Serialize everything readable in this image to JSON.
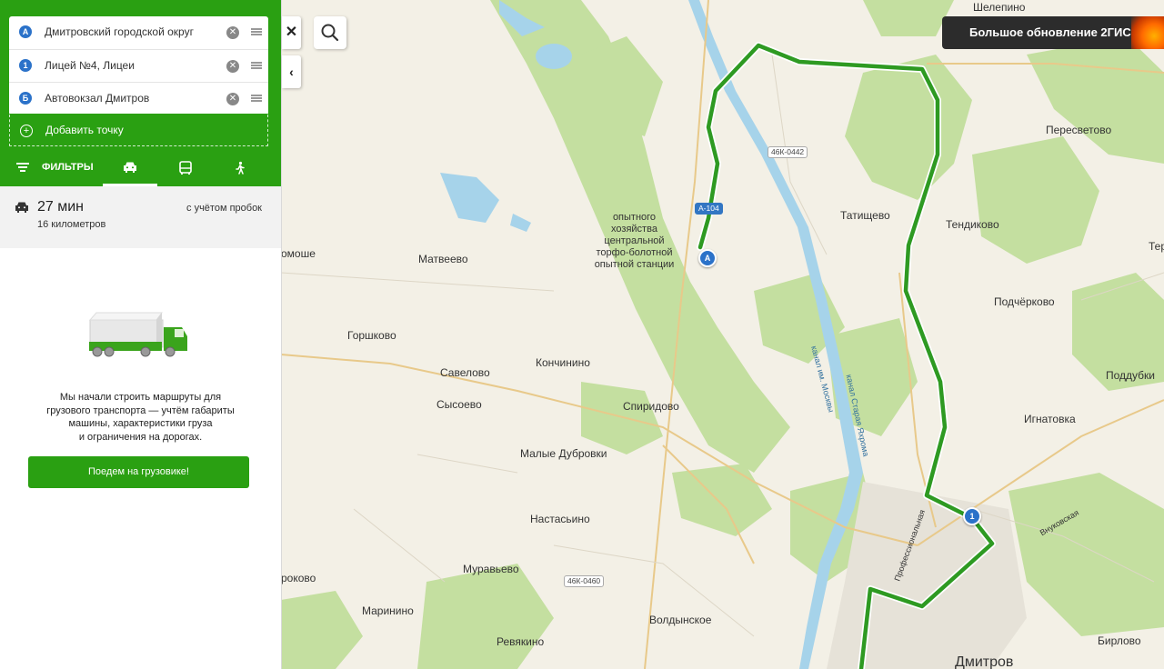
{
  "route_points": [
    {
      "marker": "А",
      "label": "Дмитровский городской округ"
    },
    {
      "marker": "1",
      "label": "Лицей №4, Лицеи"
    },
    {
      "marker": "Б",
      "label": "Автовокзал Дмитров"
    }
  ],
  "add_point_label": "Добавить точку",
  "filters_label": "ФИЛЬТРЫ",
  "transport_modes": [
    "car-icon",
    "bus-icon",
    "walk-icon"
  ],
  "active_mode": "car",
  "summary": {
    "time": "27 мин",
    "distance": "16 километров",
    "traffic_note": "с учётом пробок"
  },
  "truck_promo": {
    "text_lines": [
      "Мы начали строить маршруты для",
      "грузового транспорта — учтём габариты",
      "машины, характеристики груза",
      "и ограничения на дорогах."
    ],
    "button_label": "Поедем на грузовике!"
  },
  "banner_label": "Большое обновление 2ГИС",
  "colors": {
    "brand_green": "#2aa012",
    "route_green": "#2e9a22",
    "marker_blue": "#2b72c9",
    "river_blue": "#a6d3ea",
    "forest_green": "#c4dfa0"
  },
  "map": {
    "places": [
      "Шелепино",
      "Пересветово",
      "Татищево",
      "Тендиково",
      "Терь",
      "Подчёрково",
      "Поддубки",
      "Игнатовка",
      "Внуковская",
      "Профессиональная",
      "Бирлово",
      "Дмитров",
      "Матвеево",
      "омоше",
      "Горшково",
      "Савелово",
      "Кончинино",
      "Сысоево",
      "Спиридово",
      "Малые Дубровки",
      "Настасьино",
      "Муравьево",
      "роково",
      "Маринино",
      "Ревякино",
      "Волдынское"
    ],
    "station_label_lines": [
      "опытного",
      "хозяйства",
      "центральной",
      "торфо-болотной",
      "опытной станции"
    ],
    "road_shields": [
      "46К-0442",
      "46К-0460",
      "А-104"
    ],
    "canal_labels": [
      "канал им. Москвы",
      "канал Старая Яхрома"
    ],
    "markers": [
      "А",
      "1"
    ]
  }
}
